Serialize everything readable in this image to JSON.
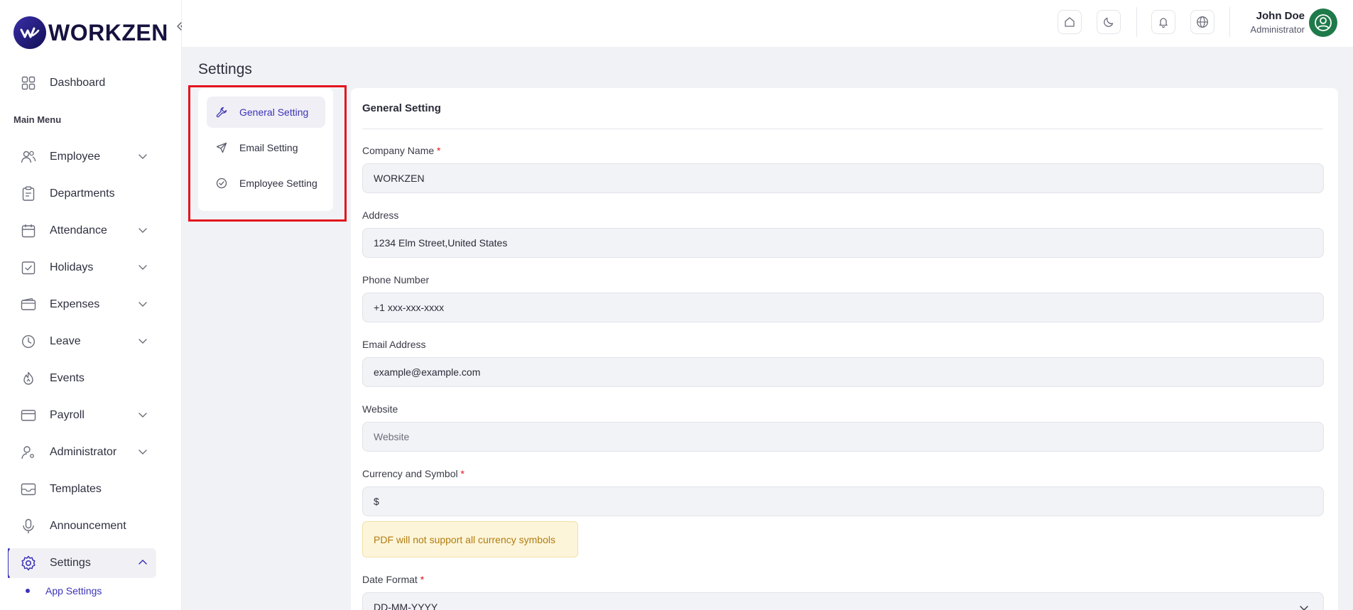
{
  "brand": {
    "name": "WORKZEN"
  },
  "sidebar": {
    "section_label": "Main Menu",
    "items": [
      {
        "label": "Dashboard",
        "icon": "dashboard-grid-icon",
        "expandable": false
      },
      {
        "label": "Employee",
        "icon": "users-icon",
        "expandable": true
      },
      {
        "label": "Departments",
        "icon": "clipboard-icon",
        "expandable": false
      },
      {
        "label": "Attendance",
        "icon": "calendar-icon",
        "expandable": true
      },
      {
        "label": "Holidays",
        "icon": "calendar-check-icon",
        "expandable": true
      },
      {
        "label": "Expenses",
        "icon": "wallet-icon",
        "expandable": true
      },
      {
        "label": "Leave",
        "icon": "clock-icon",
        "expandable": true
      },
      {
        "label": "Events",
        "icon": "flame-icon",
        "expandable": false
      },
      {
        "label": "Payroll",
        "icon": "credit-card-icon",
        "expandable": true
      },
      {
        "label": "Administrator",
        "icon": "user-gear-icon",
        "expandable": true
      },
      {
        "label": "Templates",
        "icon": "mail-template-icon",
        "expandable": false
      },
      {
        "label": "Announcement",
        "icon": "microphone-icon",
        "expandable": false
      },
      {
        "label": "Settings",
        "icon": "gear-icon",
        "expandable": true,
        "expanded": true
      }
    ],
    "sub_item": "App Settings"
  },
  "topbar": {
    "user_name": "John Doe",
    "user_role": "Administrator",
    "buttons": [
      "home-icon",
      "moon-icon",
      "bell-icon",
      "globe-icon"
    ]
  },
  "page": {
    "title": "Settings"
  },
  "settings_nav": {
    "items": [
      {
        "label": "General Setting",
        "icon": "wrench-icon",
        "active": true
      },
      {
        "label": "Email Setting",
        "icon": "send-icon",
        "active": false
      },
      {
        "label": "Employee Setting",
        "icon": "check-circle-icon",
        "active": false
      }
    ]
  },
  "form": {
    "heading": "General Setting",
    "company_name": {
      "label": "Company Name",
      "value": "WORKZEN",
      "required": "*"
    },
    "address": {
      "label": "Address",
      "value": "1234 Elm Street,United States"
    },
    "phone": {
      "label": "Phone Number",
      "value": "+1 xxx-xxx-xxxx"
    },
    "email": {
      "label": "Email Address",
      "value": "example@example.com"
    },
    "website": {
      "label": "Website",
      "value": "",
      "placeholder": "Website"
    },
    "currency": {
      "label": "Currency and Symbol",
      "value": "$",
      "required": "*"
    },
    "currency_notice": "PDF will not support all currency symbols",
    "date_format": {
      "label": "Date Format",
      "value": "DD-MM-YYYY",
      "required": "*"
    }
  },
  "colors": {
    "accent": "#3c33b8",
    "highlight_box": "#e3141d",
    "notice_bg": "#fdf5d9",
    "notice_text": "#b07c12"
  }
}
